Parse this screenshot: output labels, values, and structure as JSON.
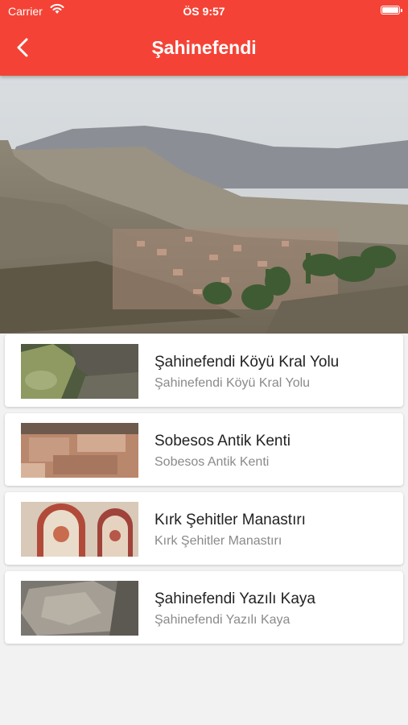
{
  "status_bar": {
    "carrier": "Carrier",
    "time": "ÖS 9:57"
  },
  "header": {
    "title": "Şahinefendi",
    "back_icon": "chevron-left-icon"
  },
  "colors": {
    "accent": "#f44336",
    "background": "#f2f2f2",
    "card": "#ffffff"
  },
  "items": [
    {
      "title": "Şahinefendi Köyü Kral Yolu",
      "subtitle": "Şahinefendi Köyü Kral Yolu"
    },
    {
      "title": "Sobesos Antik Kenti",
      "subtitle": "Sobesos Antik Kenti"
    },
    {
      "title": "Kırk Şehitler Manastırı",
      "subtitle": "Kırk Şehitler Manastırı"
    },
    {
      "title": "Şahinefendi Yazılı Kaya",
      "subtitle": "Şahinefendi Yazılı Kaya"
    }
  ]
}
